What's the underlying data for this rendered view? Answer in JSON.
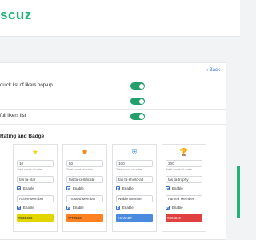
{
  "brand": "scuz",
  "back": "‹ Back",
  "options": [
    {
      "label": "quick list of likers pop-up",
      "enabled": true
    },
    {
      "label": "",
      "enabled": true
    },
    {
      "label": "full likers list",
      "enabled": true
    }
  ],
  "section": {
    "title": "Rating and Badge"
  },
  "badges": [
    {
      "icon": "★",
      "icon_name": "star-icon",
      "icon_color": "#f2d21a",
      "count": "10",
      "count_hint": "Total count of votes",
      "icon_class": "fas fa-star",
      "enable_label": "Enable",
      "name": "Active Member",
      "color": "#E3D600",
      "text_dark": false
    },
    {
      "icon": "✹",
      "icon_name": "certificate-icon",
      "icon_color": "#f08a1c",
      "count": "50",
      "count_hint": "Total count of votes",
      "icon_class": "fas fa-certificate",
      "enable_label": "Enable",
      "name": "Trusted Member",
      "color": "#FF8120",
      "text_dark": false
    },
    {
      "icon": "⛨",
      "icon_name": "shield-icon",
      "icon_color": "#3d8fe0",
      "count": "100",
      "count_hint": "Total count of votes",
      "icon_class": "fas fa-shield-alt",
      "enable_label": "Enable",
      "name": "Noble Member",
      "color": "#4A8ADF",
      "text_dark": true
    },
    {
      "icon": "🏆",
      "icon_name": "trophy-icon",
      "icon_color": "#d9352a",
      "count": "300",
      "count_hint": "Total count of votes",
      "icon_class": "fas fa-trophy",
      "enable_label": "Enable",
      "name": "Famed Member",
      "color": "#E04040",
      "text_dark": true
    }
  ]
}
